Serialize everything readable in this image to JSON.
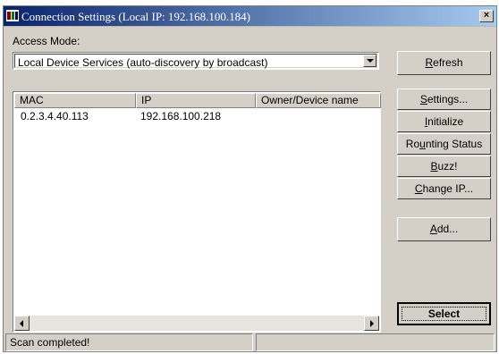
{
  "window": {
    "title": "Connection Settings (Local IP: 192.168.100.184)",
    "close_glyph": "×",
    "titlebar_color_start": "#0a246a",
    "titlebar_color_end": "#a6caf0"
  },
  "access_mode": {
    "label": "Access Mode:",
    "selected": "Local Device Services (auto-discovery by broadcast)"
  },
  "buttons": {
    "refresh": {
      "underline": "R",
      "rest": "efresh"
    },
    "settings": {
      "underline": "S",
      "rest": "ettings..."
    },
    "initialize": {
      "underline": "I",
      "rest": "nitialize"
    },
    "rounting_status": {
      "pre": "Ro",
      "underline": "u",
      "rest": "nting Status"
    },
    "buzz": {
      "underline": "B",
      "rest": "uzz!"
    },
    "change_ip": {
      "underline": "C",
      "rest": "hange IP..."
    },
    "add": {
      "underline": "A",
      "rest": "dd..."
    },
    "select": "Select"
  },
  "device_list": {
    "columns": [
      "MAC",
      "IP",
      "Owner/Device name"
    ],
    "rows": [
      {
        "mac": "0.2.3.4.40.113",
        "ip": "192.168.100.218",
        "owner": ""
      }
    ]
  },
  "status": {
    "text": "Scan completed!",
    "secondary": ""
  },
  "icons": {
    "app": "network-app-icon",
    "close": "close-icon",
    "dropdown": "chevron-down-icon",
    "scroll_left": "scroll-left-icon",
    "scroll_right": "scroll-right-icon"
  }
}
